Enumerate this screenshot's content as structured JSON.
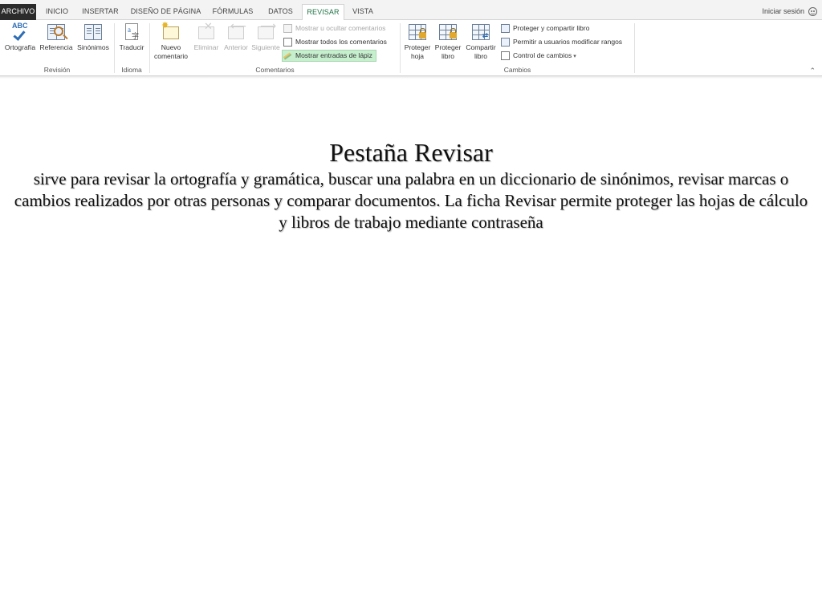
{
  "tabs": [
    {
      "label": "ARCHIVO"
    },
    {
      "label": "INICIO"
    },
    {
      "label": "INSERTAR"
    },
    {
      "label": "DISEÑO DE PÁGINA"
    },
    {
      "label": "FÓRMULAS"
    },
    {
      "label": "DATOS"
    },
    {
      "label": "REVISAR"
    },
    {
      "label": "VISTA"
    }
  ],
  "active_tab": "REVISAR",
  "signin_label": "Iniciar sesión",
  "ribbon": {
    "revision": {
      "label": "Revisión",
      "spelling": "Ortografía",
      "research": "Referencia",
      "thesaurus": "Sinónimos",
      "abc": "ABC"
    },
    "idioma": {
      "label": "Idioma",
      "translate": "Traducir"
    },
    "comentarios": {
      "label": "Comentarios",
      "new_comment_1": "Nuevo",
      "new_comment_2": "comentario",
      "delete": "Eliminar",
      "previous": "Anterior",
      "next": "Siguiente",
      "show_hide": "Mostrar u ocultar comentarios",
      "show_all": "Mostrar todos los comentarios",
      "show_ink": "Mostrar entradas de lápiz"
    },
    "cambios": {
      "label": "Cambios",
      "protect_sheet_1": "Proteger",
      "protect_sheet_2": "hoja",
      "protect_book_1": "Proteger",
      "protect_book_2": "libro",
      "share_book_1": "Compartir",
      "share_book_2": "libro",
      "protect_share": "Proteger y compartir libro",
      "allow_users": "Permitir a usuarios modificar rangos",
      "track_changes": "Control de cambios"
    }
  },
  "slide": {
    "title": "Pestaña Revisar",
    "description": "sirve para revisar la ortografía y gramática, buscar una palabra en un diccionario de sinónimos, revisar marcas o cambios realizados por otras personas y comparar documentos. La ficha Revisar permite proteger las hojas de cálculo y libros de trabajo mediante contraseña"
  },
  "colors": {
    "accent": "#217346",
    "file_tab": "#2b2b2b",
    "highlight": "#c6efce"
  }
}
